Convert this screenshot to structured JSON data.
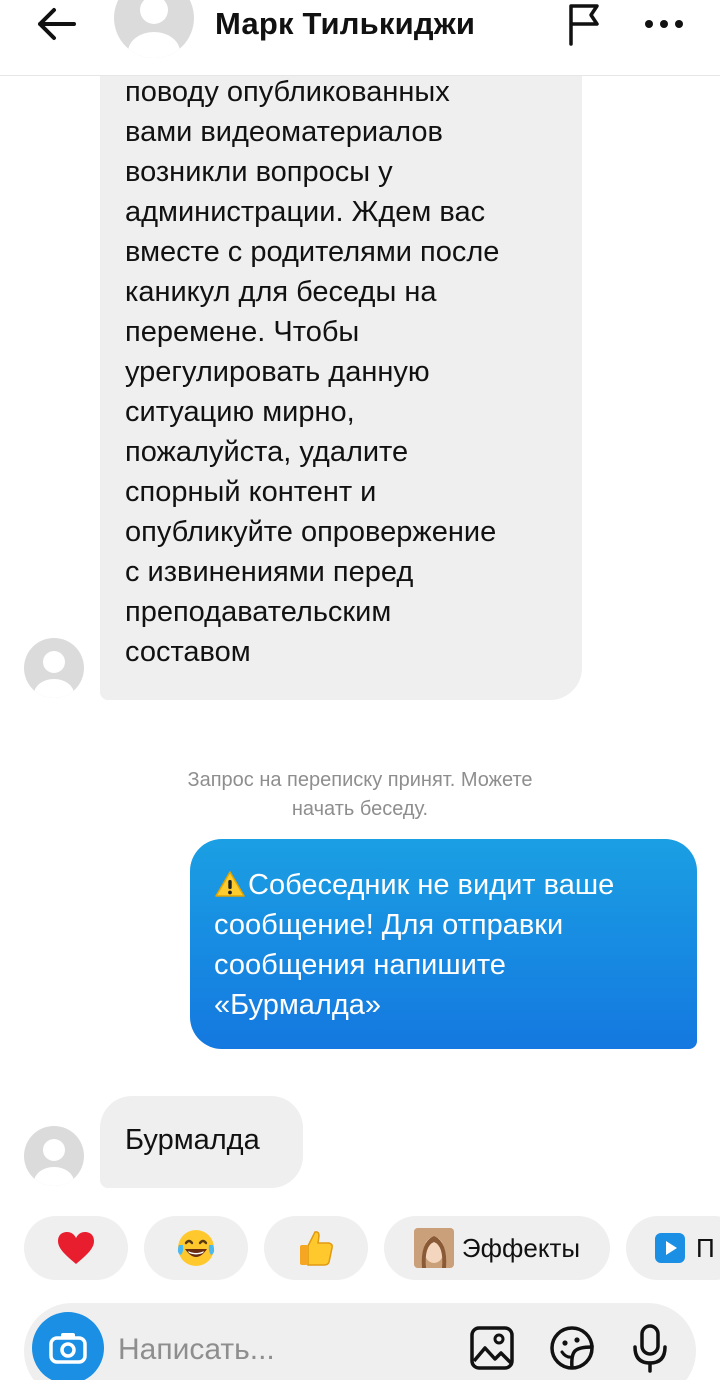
{
  "header": {
    "contact_name": "Марк Тилькиджи",
    "icons": [
      "back-arrow-icon",
      "avatar-placeholder",
      "flag-icon",
      "more-options-icon"
    ]
  },
  "messages": [
    {
      "direction": "incoming",
      "lines": [
        "поводу опубликованных",
        "вами видеоматериалов",
        "возникли вопросы у",
        "администрации. Ждем вас",
        "вместе с родителями после",
        "каникул для беседы на",
        "перемене. Чтобы",
        "урегулировать данную",
        "ситуацию мирно,",
        "пожалуйста, удалите",
        "спорный контент и",
        "опубликуйте опровержение",
        "с извинениями перед",
        "преподавательским",
        "составом"
      ]
    },
    {
      "direction": "system",
      "lines": [
        "Запрос на переписку принят. Можете",
        "начать беседу."
      ]
    },
    {
      "direction": "outgoing",
      "lines": [
        "Собеседник не видит ваше",
        "сообщение! Для отправки",
        "сообщения напишите",
        "«Бурмалда»"
      ]
    },
    {
      "direction": "incoming",
      "lines": [
        "Бурмалда"
      ]
    }
  ],
  "quick_reactions": {
    "items": [
      "heart-emoji",
      "tears-of-joy-emoji",
      "thumbs-up-emoji"
    ],
    "effects_label": "Эффекты",
    "partial_label": "П"
  },
  "composer": {
    "placeholder": "Написать...",
    "icons": [
      "camera-icon",
      "gallery-icon",
      "sticker-icon",
      "microphone-icon"
    ]
  },
  "colors": {
    "outgoing_bubble_top": "#1b9fe3",
    "outgoing_bubble_bottom": "#1478e0",
    "incoming_bubble": "#efefef",
    "camera_button": "#1a8fe3",
    "system_text": "#8e8e8e"
  }
}
